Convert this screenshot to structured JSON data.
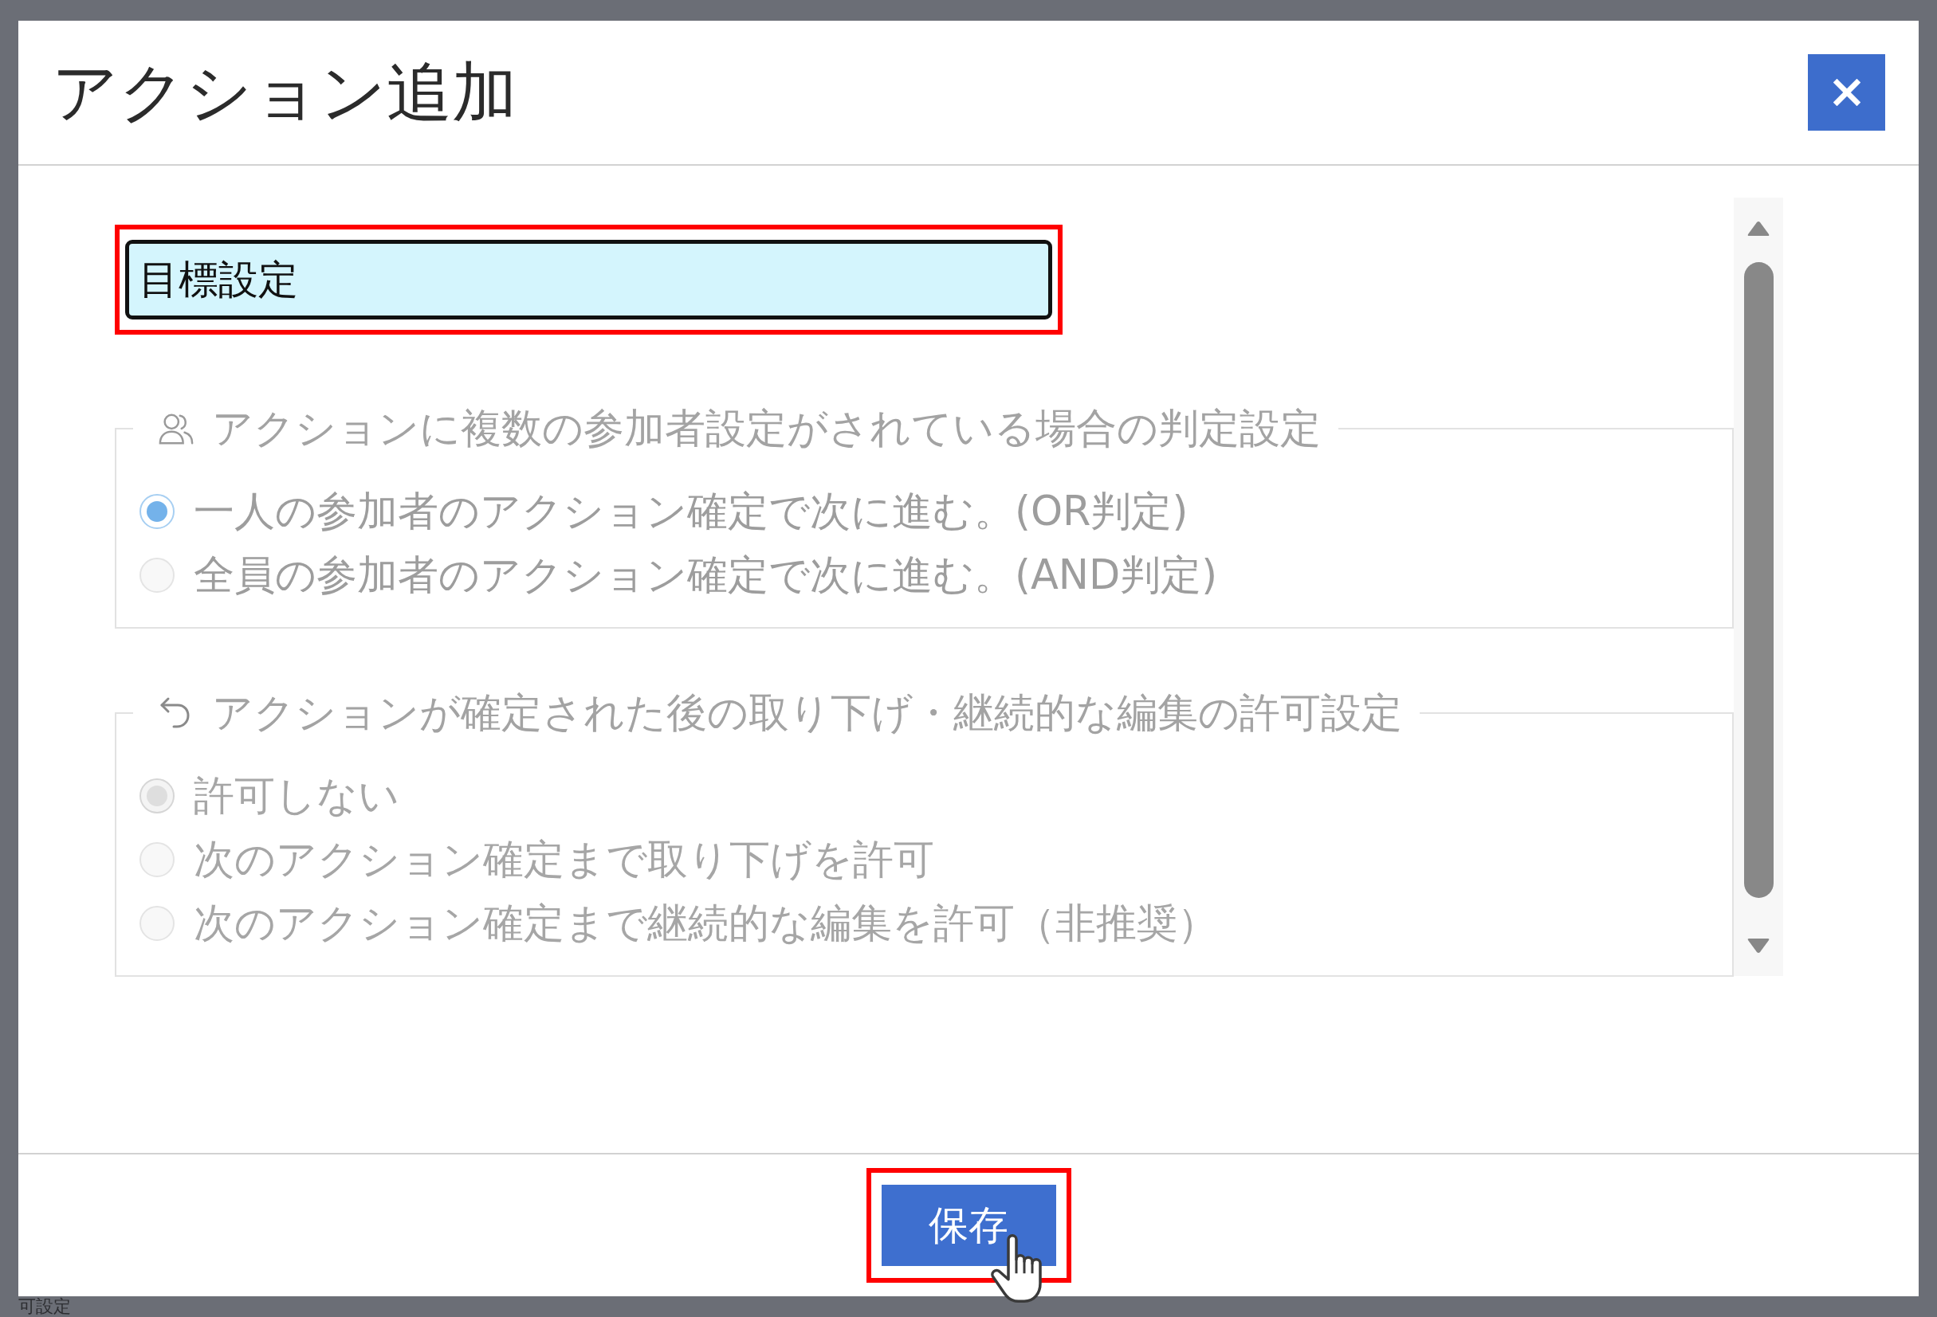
{
  "dialog": {
    "title": "アクション追加",
    "name_field": {
      "value": "目標設定",
      "highlighted": true
    },
    "groups": [
      {
        "kind": "users",
        "legend": "アクションに複数の参加者設定がされている場合の判定設定",
        "disabled": false,
        "options": [
          {
            "label": "一人の参加者のアクション確定で次に進む。(OR判定)",
            "selected": true
          },
          {
            "label": "全員の参加者のアクション確定で次に進む。(AND判定)",
            "selected": false
          }
        ]
      },
      {
        "kind": "undo",
        "legend": "アクションが確定された後の取り下げ・継続的な編集の許可設定",
        "disabled": true,
        "options": [
          {
            "label": "許可しない",
            "selected": true
          },
          {
            "label": "次のアクション確定まで取り下げを許可",
            "selected": false
          },
          {
            "label": "次のアクション確定まで継続的な編集を許可（非推奨）",
            "selected": false
          }
        ]
      }
    ],
    "save_button": {
      "label": "保存",
      "highlighted": true
    }
  },
  "background": {
    "texts": [
      "可設定"
    ]
  }
}
